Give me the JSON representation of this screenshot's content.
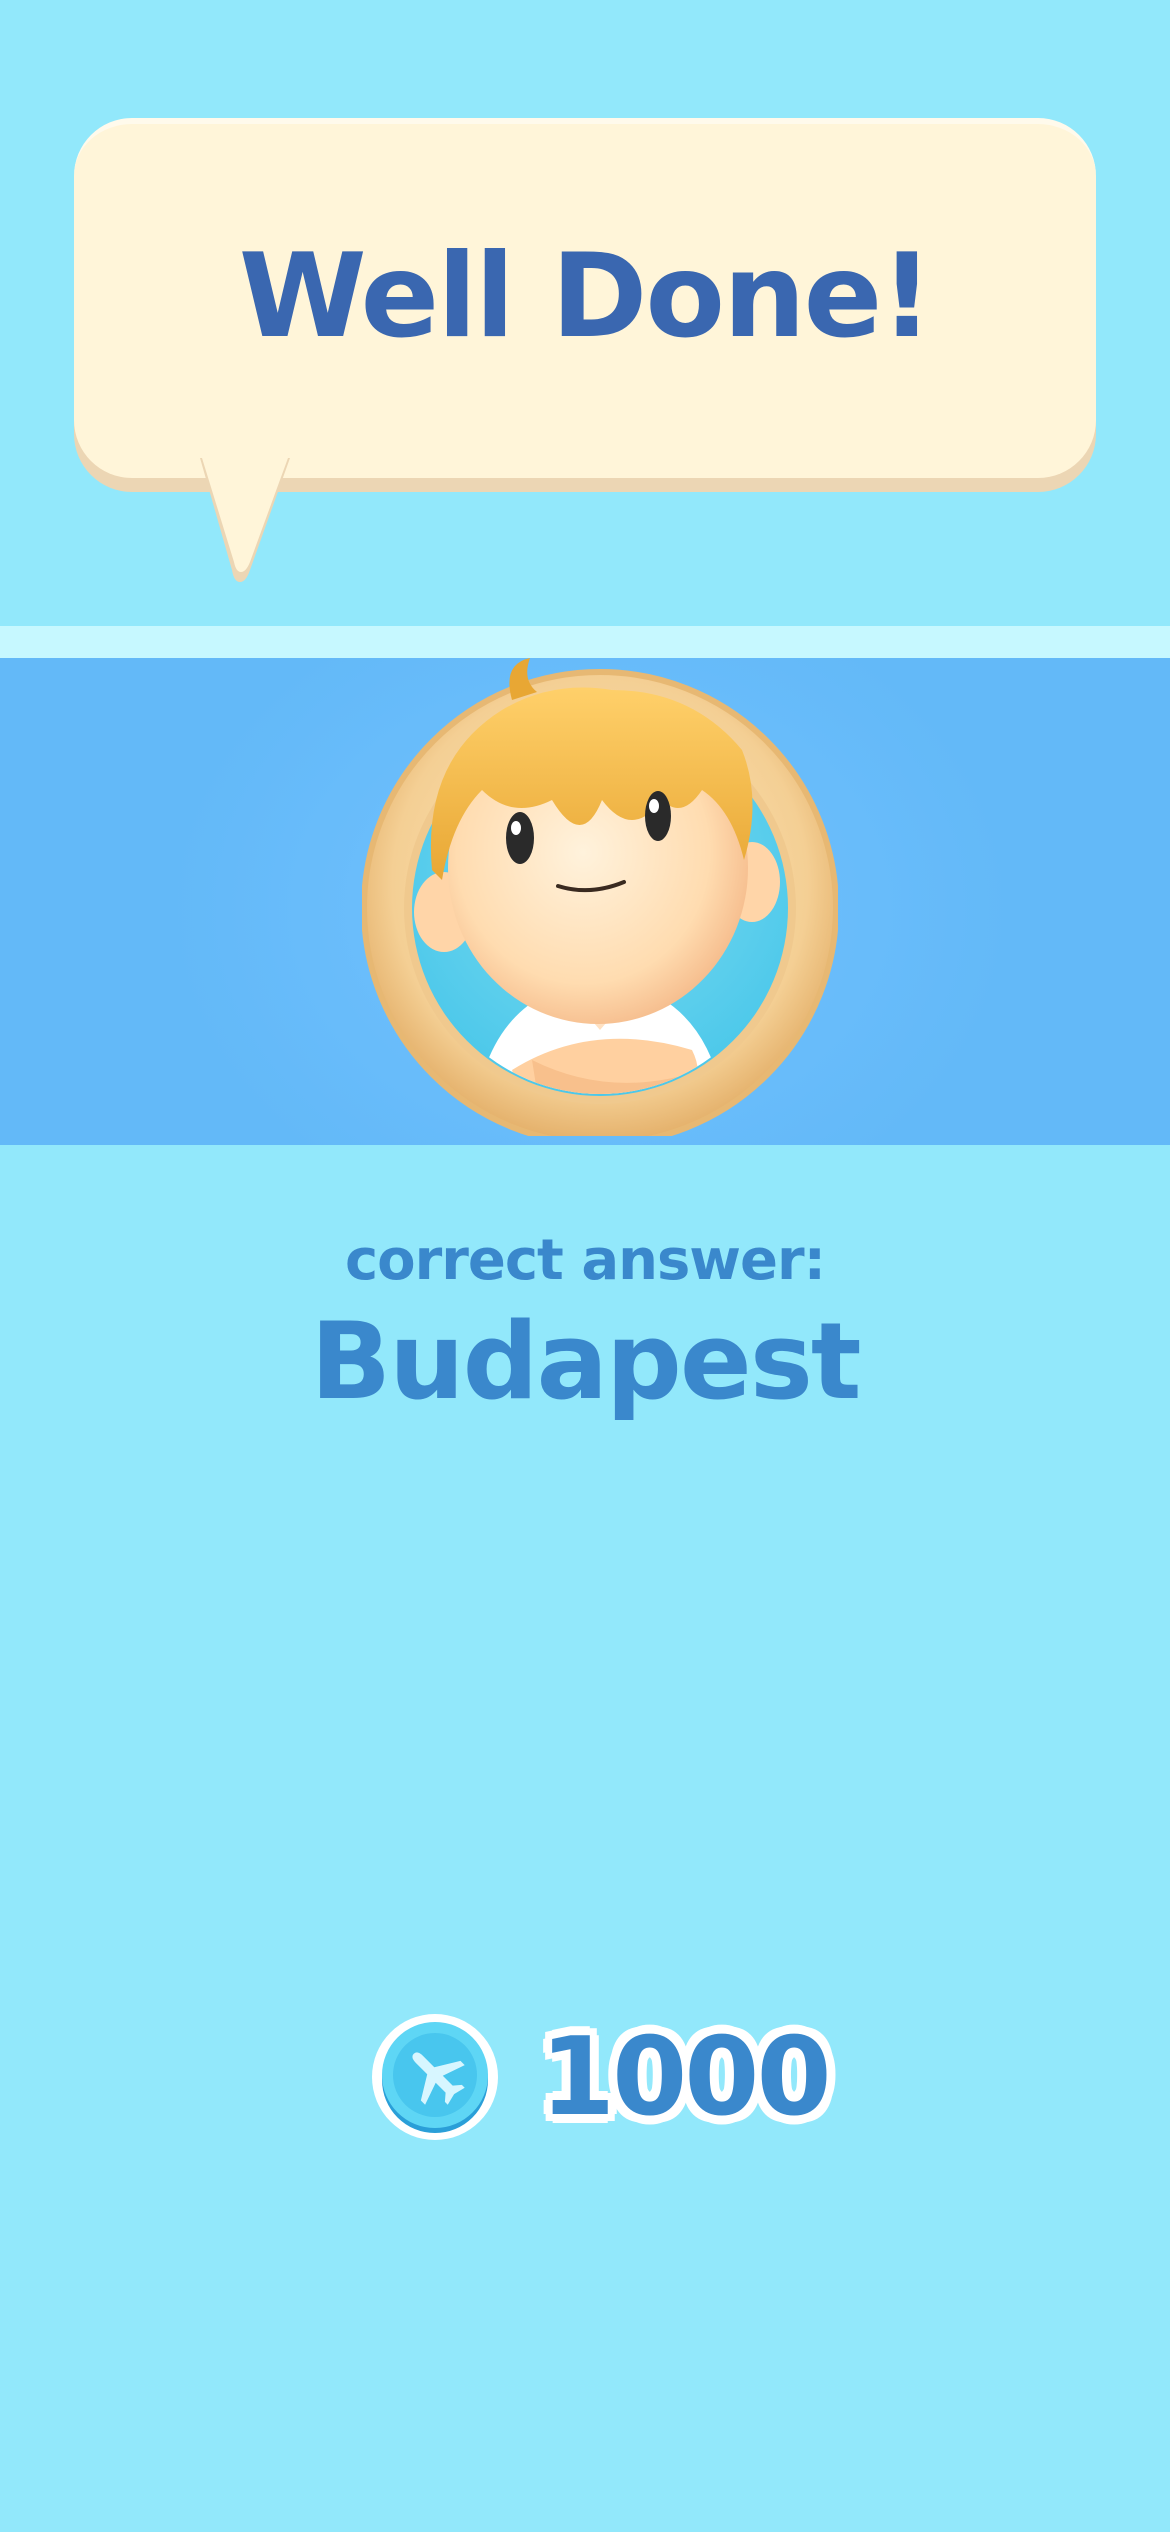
{
  "bubble": {
    "title": "Well Done!"
  },
  "result": {
    "label": "correct answer:",
    "answer": "Budapest"
  },
  "reward": {
    "coin_icon": "plane-coin-icon",
    "amount": "1000"
  },
  "avatar": {
    "icon": "character-avatar"
  },
  "colors": {
    "background": "#92e8fb",
    "banner": "#63b9f8",
    "bubble": "#fff5d9",
    "title_text": "#3a67b0",
    "answer_text": "#3a88cc"
  }
}
